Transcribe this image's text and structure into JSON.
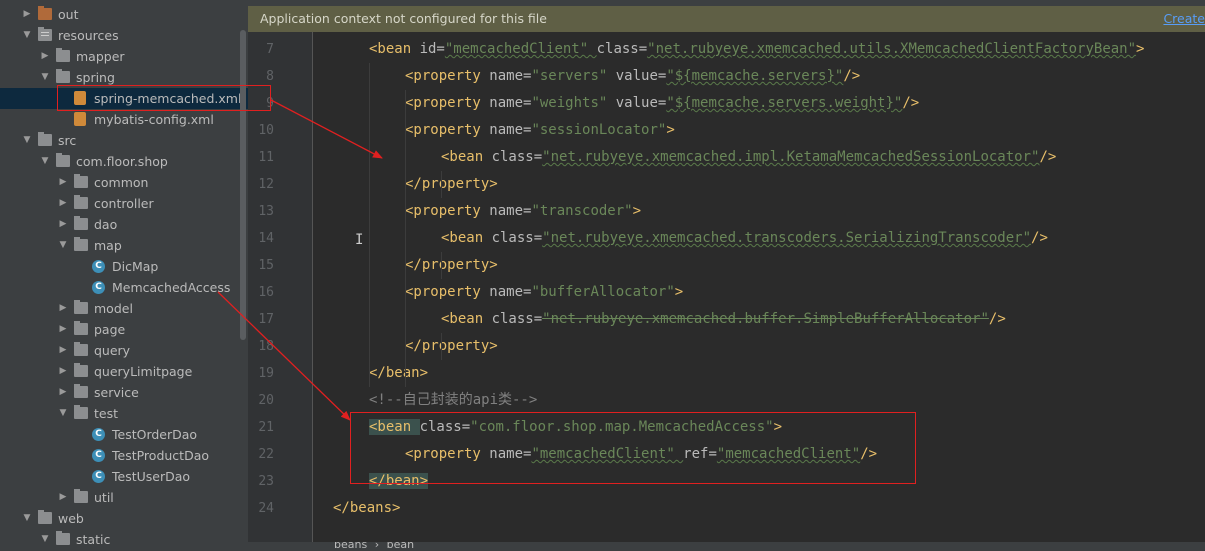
{
  "banner": {
    "text": "Application context not configured for this file",
    "link": "Create"
  },
  "tree": [
    {
      "label": "out",
      "twisty": "▶",
      "icon": "folder-orange"
    },
    {
      "label": "resources",
      "twisty": "▼",
      "icon": "folder-resources"
    },
    {
      "label": "mapper",
      "twisty": "▶",
      "icon": "folder"
    },
    {
      "label": "spring",
      "twisty": "▼",
      "icon": "folder"
    },
    {
      "label": "spring-memcached.xml",
      "twisty": "",
      "icon": "xml-file",
      "selected": true
    },
    {
      "label": "mybatis-config.xml",
      "twisty": "",
      "icon": "xml-file"
    },
    {
      "label": "src",
      "twisty": "▼",
      "icon": "folder"
    },
    {
      "label": "com.floor.shop",
      "twisty": "▼",
      "icon": "folder"
    },
    {
      "label": "common",
      "twisty": "▶",
      "icon": "folder"
    },
    {
      "label": "controller",
      "twisty": "▶",
      "icon": "folder"
    },
    {
      "label": "dao",
      "twisty": "▶",
      "icon": "folder"
    },
    {
      "label": "map",
      "twisty": "▼",
      "icon": "folder"
    },
    {
      "label": "DicMap",
      "twisty": "",
      "icon": "class"
    },
    {
      "label": "MemcachedAccess",
      "twisty": "",
      "icon": "class"
    },
    {
      "label": "model",
      "twisty": "▶",
      "icon": "folder"
    },
    {
      "label": "page",
      "twisty": "▶",
      "icon": "folder"
    },
    {
      "label": "query",
      "twisty": "▶",
      "icon": "folder"
    },
    {
      "label": "queryLimitpage",
      "twisty": "▶",
      "icon": "folder"
    },
    {
      "label": "service",
      "twisty": "▶",
      "icon": "folder"
    },
    {
      "label": "test",
      "twisty": "▼",
      "icon": "folder"
    },
    {
      "label": "TestOrderDao",
      "twisty": "",
      "icon": "class"
    },
    {
      "label": "TestProductDao",
      "twisty": "",
      "icon": "class"
    },
    {
      "label": "TestUserDao",
      "twisty": "",
      "icon": "class"
    },
    {
      "label": "util",
      "twisty": "▶",
      "icon": "folder"
    },
    {
      "label": "web",
      "twisty": "▼",
      "icon": "folder"
    },
    {
      "label": "static",
      "twisty": "▼",
      "icon": "folder"
    }
  ],
  "line_numbers": [
    "7",
    "8",
    "9",
    "10",
    "11",
    "12",
    "13",
    "14",
    "15",
    "16",
    "17",
    "18",
    "19",
    "20",
    "21",
    "22",
    "23",
    "24"
  ],
  "code_lines": [
    [
      [
        "tag",
        "<bean "
      ],
      [
        "attr",
        "id="
      ],
      [
        "val",
        "\"memcachedClient\" "
      ],
      [
        "attr",
        "class="
      ],
      [
        "val",
        "\"net.rubyeye.xmemcached.utils.XMemcachedClientFactoryBean\""
      ],
      [
        "tag",
        ">"
      ]
    ],
    [
      [
        "tag",
        "<property "
      ],
      [
        "attr",
        "name="
      ],
      [
        "val",
        "\"servers\" "
      ],
      [
        "attr",
        "value="
      ],
      [
        "val",
        "\"${memcache.servers}\""
      ],
      [
        "tag",
        "/>"
      ]
    ],
    [
      [
        "tag",
        "<property "
      ],
      [
        "attr",
        "name="
      ],
      [
        "val",
        "\"weights\" "
      ],
      [
        "attr",
        "value="
      ],
      [
        "val",
        "\"${memcache.servers.weight}\""
      ],
      [
        "tag",
        "/>"
      ]
    ],
    [
      [
        "tag",
        "<property "
      ],
      [
        "attr",
        "name="
      ],
      [
        "val",
        "\"sessionLocator\""
      ],
      [
        "tag",
        ">"
      ]
    ],
    [
      [
        "tag",
        "<bean "
      ],
      [
        "attr",
        "class="
      ],
      [
        "val",
        "\"net.rubyeye.xmemcached.impl.KetamaMemcachedSessionLocator\""
      ],
      [
        "tag",
        "/>"
      ]
    ],
    [
      [
        "tag",
        "</property>"
      ]
    ],
    [
      [
        "tag",
        "<property "
      ],
      [
        "attr",
        "name="
      ],
      [
        "val",
        "\"transcoder\""
      ],
      [
        "tag",
        ">"
      ]
    ],
    [
      [
        "tag",
        "<bean "
      ],
      [
        "attr",
        "class="
      ],
      [
        "val",
        "\"net.rubyeye.xmemcached.transcoders.SerializingTranscoder\""
      ],
      [
        "tag",
        "/>"
      ]
    ],
    [
      [
        "tag",
        "</property>"
      ]
    ],
    [
      [
        "tag",
        "<property "
      ],
      [
        "attr",
        "name="
      ],
      [
        "val",
        "\"bufferAllocator\""
      ],
      [
        "tag",
        ">"
      ]
    ],
    [
      [
        "tag",
        "<bean "
      ],
      [
        "attr",
        "class="
      ],
      [
        "val",
        "\"net.rubyeye.xmemcached.buffer.SimpleBufferAllocator\""
      ],
      [
        "tag",
        "/>"
      ]
    ],
    [
      [
        "tag",
        "</property>"
      ]
    ],
    [
      [
        "tag",
        "</bean>"
      ]
    ],
    [
      [
        "comment",
        "<!--自己封装的api类-->"
      ]
    ],
    [
      [
        "tag",
        "<bean "
      ],
      [
        "attr",
        "class="
      ],
      [
        "val",
        "\"com.floor.shop.map.MemcachedAccess\""
      ],
      [
        "tag",
        ">"
      ]
    ],
    [
      [
        "tag",
        "<property "
      ],
      [
        "attr",
        "name="
      ],
      [
        "val",
        "\"memcachedClient\" "
      ],
      [
        "attr",
        "ref="
      ],
      [
        "val",
        "\"memcachedClient\""
      ],
      [
        "tag",
        "/>"
      ]
    ],
    [
      [
        "tag",
        "</bean>"
      ]
    ],
    [
      [
        "tag",
        "</beans>"
      ]
    ]
  ],
  "code_indents": [
    1,
    2,
    2,
    2,
    3,
    2,
    2,
    3,
    2,
    2,
    3,
    2,
    1,
    1,
    1,
    2,
    1,
    0
  ],
  "breadcrumb": {
    "items": [
      "beans",
      "bean"
    ]
  },
  "colors": {
    "annotation": "#e02020",
    "tag": "#e8bf6a",
    "string": "#6a8759",
    "attribute": "#bababa",
    "comment": "#808080"
  }
}
